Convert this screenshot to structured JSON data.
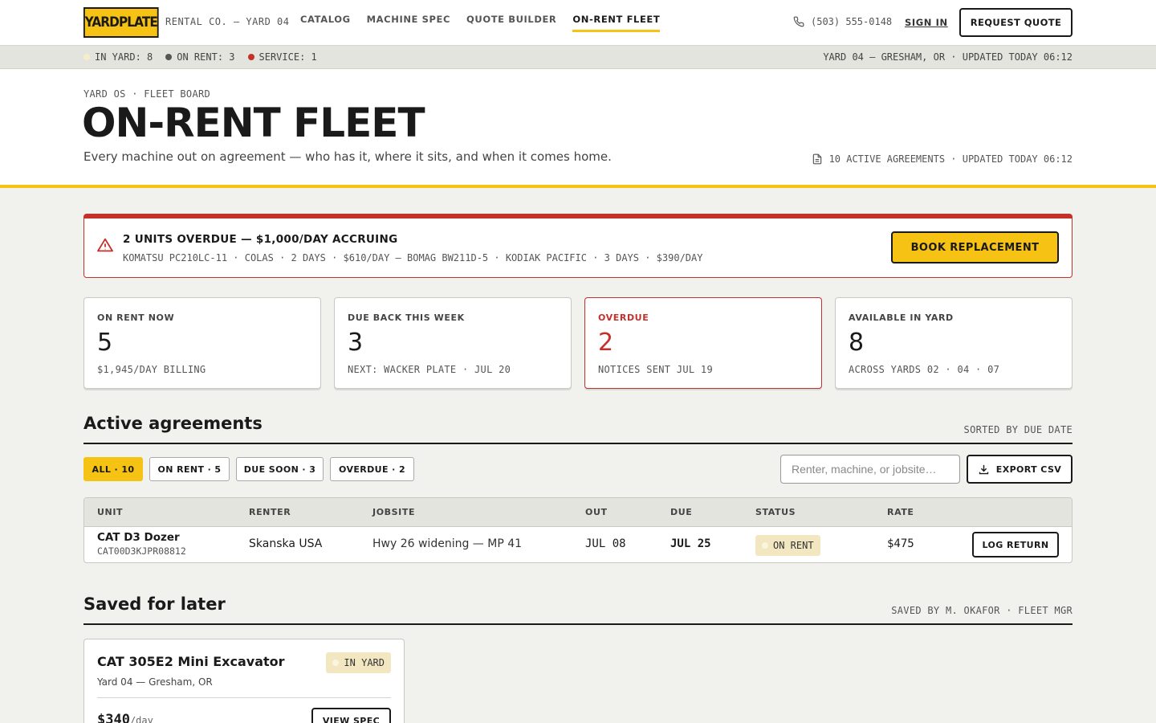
{
  "nav": {
    "logo": "YARDPLATE",
    "logo_sub": "RENTAL CO. — YARD 04",
    "links": [
      "CATALOG",
      "MACHINE SPEC",
      "QUOTE BUILDER",
      "ON-RENT FLEET"
    ],
    "active_link": "ON-RENT FLEET",
    "phone": "(503) 555-0148",
    "sign_in": "SIGN IN",
    "request_quote": "REQUEST QUOTE"
  },
  "status_strip": {
    "in_yard": "IN YARD: 8",
    "on_rent": "ON RENT: 3",
    "service": "SERVICE: 1",
    "right": "YARD 04 — GRESHAM, OR · UPDATED TODAY 06:12"
  },
  "header": {
    "crumb": "YARD OS · FLEET BOARD",
    "title": "ON-RENT FLEET",
    "lede": "Every machine out on agreement — who has it, where it sits, and when it comes home.",
    "meta": "10 ACTIVE AGREEMENTS · UPDATED TODAY 06:12"
  },
  "alert": {
    "title": "2 UNITS OVERDUE — $1,000/DAY ACCRUING",
    "detail": "KOMATSU PC210LC-11 · COLAS · 2 DAYS · $610/DAY — BOMAG BW211D-5 · KODIAK PACIFIC · 3 DAYS · $390/DAY",
    "button": "BOOK REPLACEMENT"
  },
  "stats": [
    {
      "label": "ON RENT NOW",
      "value": "5",
      "sub": "$1,945/DAY BILLING"
    },
    {
      "label": "DUE BACK THIS WEEK",
      "value": "3",
      "sub": "NEXT: WACKER PLATE · JUL 20"
    },
    {
      "label": "OVERDUE",
      "value": "2",
      "sub": "NOTICES SENT JUL 19"
    },
    {
      "label": "AVAILABLE IN YARD",
      "value": "8",
      "sub": "ACROSS YARDS 02 · 04 · 07"
    }
  ],
  "agreements": {
    "title": "Active agreements",
    "sort": "SORTED BY DUE DATE",
    "filters": [
      "ALL · 10",
      "ON RENT · 5",
      "DUE SOON · 3",
      "OVERDUE · 2"
    ],
    "search_placeholder": "Renter, machine, or jobsite…",
    "export": "EXPORT CSV",
    "columns": [
      "UNIT",
      "RENTER",
      "JOBSITE",
      "OUT",
      "DUE",
      "STATUS",
      "RATE"
    ],
    "rows": [
      {
        "unit": "CAT D3 Dozer",
        "serial": "CAT00D3KJPR08812",
        "renter": "Skanska USA",
        "jobsite": "Hwy 26 widening — MP 41",
        "out": "JUL 08",
        "due": "JUL 25",
        "status": "ON RENT",
        "rate": "$475",
        "action": "LOG RETURN"
      }
    ]
  },
  "saved": {
    "title": "Saved for later",
    "meta": "SAVED BY M. OKAFOR · FLEET MGR",
    "card": {
      "name": "CAT 305E2 Mini Excavator",
      "location": "Yard 04 — Gresham, OR",
      "status": "IN YARD",
      "price": "$340",
      "per": "/day",
      "button": "VIEW SPEC"
    }
  },
  "colors": {
    "accent": "#f6c315",
    "danger": "#c3312a",
    "ink": "#1a1a1a"
  }
}
